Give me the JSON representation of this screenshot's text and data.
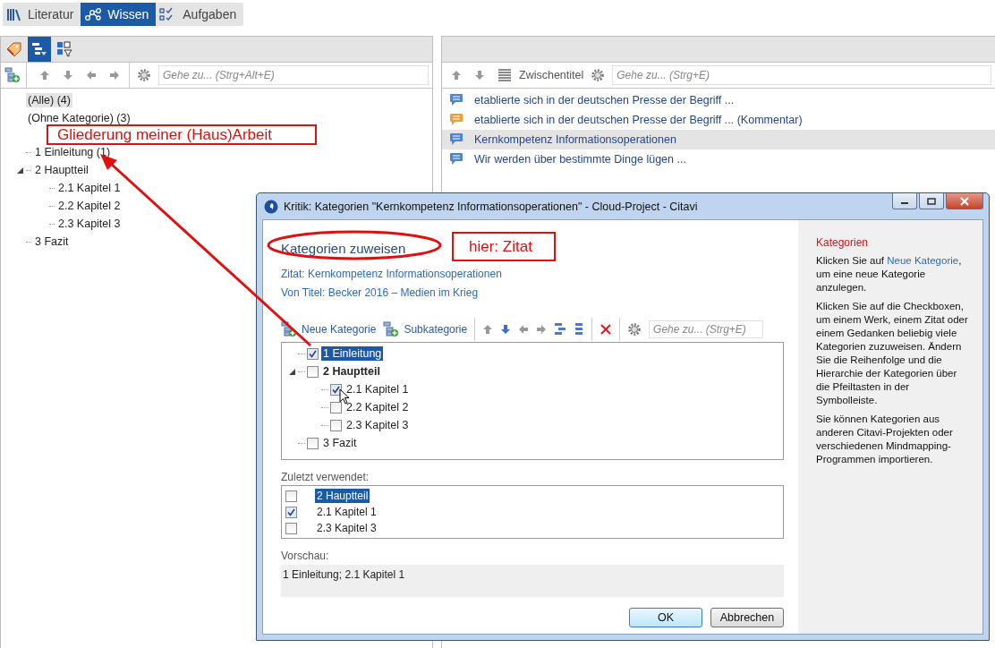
{
  "main_tabs": [
    {
      "label": "Literatur",
      "kind": "books",
      "selected": false
    },
    {
      "label": "Wissen",
      "kind": "network",
      "selected": true
    },
    {
      "label": "Aufgaben",
      "kind": "tasks",
      "selected": false
    }
  ],
  "left_pane": {
    "view_buttons": [
      {
        "kind": "tag",
        "selected": false
      },
      {
        "kind": "outline",
        "selected": true
      },
      {
        "kind": "filter",
        "selected": false
      }
    ],
    "search": {
      "placeholder": "Gehe zu... (Strg+Alt+E)"
    },
    "filters": [
      {
        "label": "(Alle) (4)",
        "selected": true
      },
      {
        "label": "(Ohne Kategorie) (3)",
        "selected": false
      }
    ],
    "tree": [
      {
        "label": "1 Einleitung (1)"
      },
      {
        "label": "2 Hauptteil",
        "expanded": true,
        "children": [
          {
            "label": "2.1 Kapitel 1"
          },
          {
            "label": "2.2 Kapitel 2"
          },
          {
            "label": "2.3 Kapitel 3"
          }
        ]
      },
      {
        "label": "3 Fazit"
      }
    ]
  },
  "right_pane": {
    "toolbar_label": "Zwischentitel",
    "search": {
      "placeholder": "Gehe zu... (Strg+E)"
    },
    "items": [
      {
        "text": "etablierte sich in der deutschen Presse der Begriff ...",
        "color": "#4a86d8",
        "selected": false
      },
      {
        "text": "etablierte sich in der deutschen Presse der Begriff ... (Kommentar)",
        "color": "#f0a030",
        "selected": false
      },
      {
        "text": "Kernkompetenz Informationsoperationen",
        "color": "#4a86d8",
        "selected": true
      },
      {
        "text": "Wir werden über bestimmte Dinge lügen ...",
        "color": "#4a86d8",
        "selected": false
      }
    ]
  },
  "dialog": {
    "title": "Kritik: Kategorien \"Kernkompetenz Informationsoperationen\" - Cloud-Project - Citavi",
    "heading": "Kategorien zuweisen",
    "info_lines": [
      "Zitat: Kernkompetenz Informationsoperationen",
      "Von Titel: Becker 2016 – Medien im Krieg"
    ],
    "toolbar_buttons": [
      {
        "label": "Neue Kategorie"
      },
      {
        "label": "Subkategorie"
      }
    ],
    "search": {
      "placeholder": "Gehe zu... (Strg+E)"
    },
    "tree": [
      {
        "label": "1 Einleitung",
        "checked": true,
        "selected": true,
        "has_checked_children": false
      },
      {
        "label": "2 Hauptteil",
        "checked": false,
        "selected": false,
        "has_checked_children": true,
        "expanded": true,
        "children": [
          {
            "label": "2.1 Kapitel 1",
            "checked": true,
            "selected": false,
            "has_checked_children": false
          },
          {
            "label": "2.2 Kapitel 2",
            "checked": false,
            "selected": false,
            "has_checked_children": false
          },
          {
            "label": "2.3 Kapitel 3",
            "checked": false,
            "selected": false,
            "has_checked_children": false
          }
        ]
      },
      {
        "label": "3 Fazit",
        "checked": false,
        "selected": false,
        "has_checked_children": false
      }
    ],
    "recent_label": "Zuletzt verwendet:",
    "recent": [
      {
        "label": "2 Hauptteil",
        "checked": false,
        "selected": true
      },
      {
        "label": "2.1 Kapitel 1",
        "checked": true,
        "selected": false
      },
      {
        "label": "2.3 Kapitel 3",
        "checked": false,
        "selected": false
      }
    ],
    "preview_label": "Vorschau:",
    "preview": "1 Einleitung; 2.1 Kapitel 1",
    "buttons": [
      {
        "label": "OK",
        "default": true
      },
      {
        "label": "Abbrechen",
        "default": false
      }
    ],
    "help": {
      "title": "Kategorien",
      "paragraphs": [
        {
          "before": "Klicken Sie auf ",
          "link": "Neue Kategorie",
          "after": ", um eine neue Kategorie anzulegen."
        },
        {
          "before": "Klicken Sie auf die Checkboxen, um einem Werk, einem Zitat oder einem Gedanken beliebig viele Kategorien zuzuweisen. Ändern Sie die Reihenfolge und die Hierarchie der Kategorien über die Pfeiltasten in der Symbolleiste."
        },
        {
          "before": "Sie können Kategorien aus anderen Citavi-Projekten oder verschiedenen Mindmapping-Programmen importieren."
        }
      ]
    }
  },
  "annotations": {
    "outline_note": "Gliederung meiner (Haus)Arbeit",
    "dialog_note": "hier: Zitat"
  }
}
